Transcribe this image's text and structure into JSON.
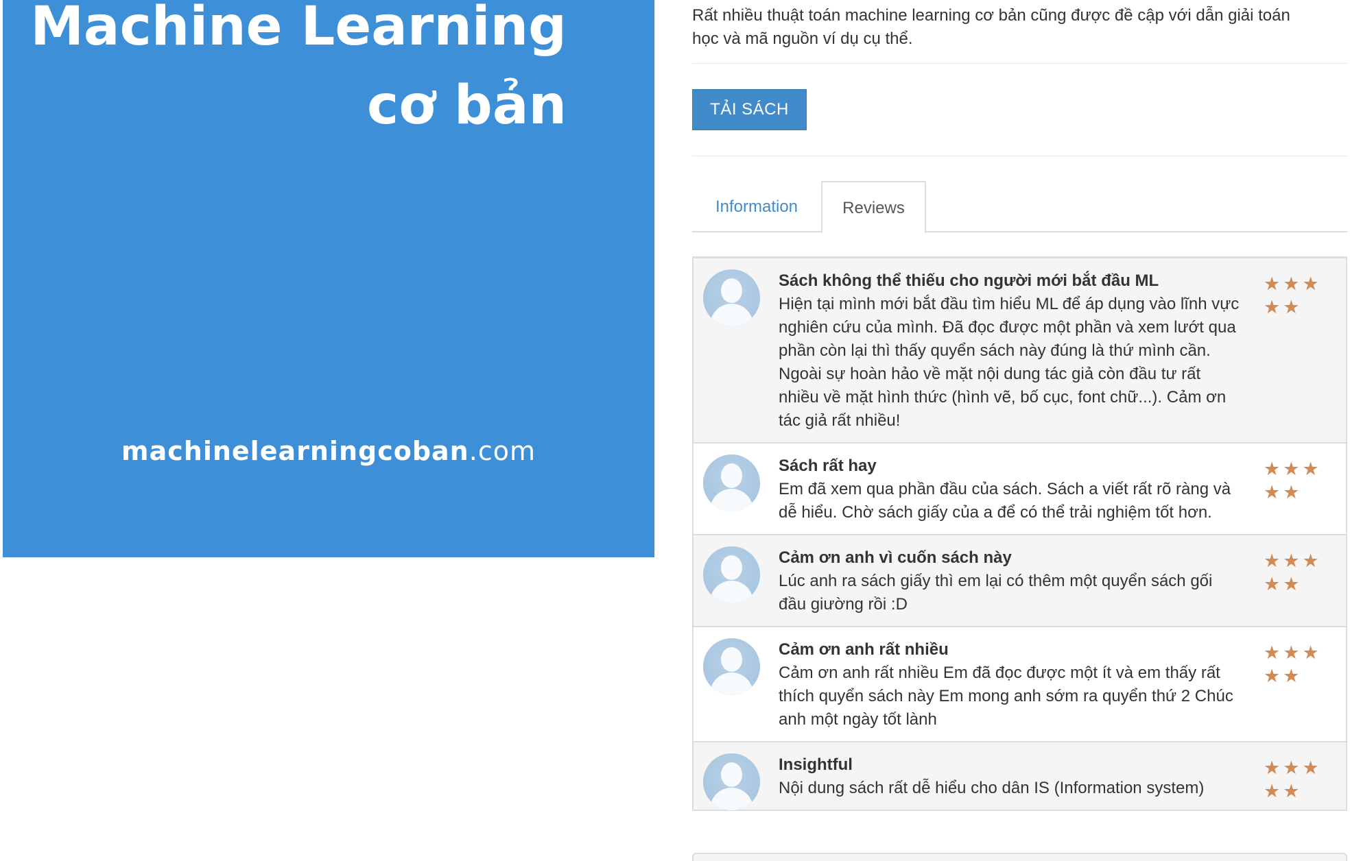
{
  "cover": {
    "title_line1": "Machine Learning",
    "title_line2": "cơ bản",
    "url_main": "machinelearningcoban",
    "url_tld": ".com",
    "background_color": "#3d8fd8"
  },
  "description": {
    "line1": "Rất nhiều thuật toán machine learning cơ bản cũng được đề cập với dẫn giải toán",
    "line2": "học và mã nguồn ví dụ cụ thể."
  },
  "download_button": {
    "label": "TẢI SÁCH"
  },
  "tabs": {
    "information": "Information",
    "reviews": "Reviews"
  },
  "reviews": [
    {
      "title": "Sách không thể thiếu cho người mới bắt đầu ML",
      "text": "Hiện tại mình mới bắt đầu tìm hiểu ML để áp dụng vào lĩnh vực nghiên cứu của mình. Đã đọc được một phần và xem lướt qua phần còn lại thì thấy quyển sách này đúng là thứ mình cần. Ngoài sự hoàn hảo về mặt nội dung tác giả còn đầu tư rất nhiều về mặt hình thức (hình vẽ, bố cục, font chữ...). Cảm ơn tác giả rất nhiều!",
      "rating": 5
    },
    {
      "title": "Sách rất hay",
      "text": "Em đã xem qua phần đầu của sách. Sách a viết rất rõ ràng và dễ hiểu. Chờ sách giấy của a để có thể trải nghiệm tốt hơn.",
      "rating": 5
    },
    {
      "title": "Cảm ơn anh vì cuốn sách này",
      "text": "Lúc anh ra sách giấy thì em lại có thêm một quyển sách gối đầu giường rồi :D",
      "rating": 5
    },
    {
      "title": "Cảm ơn anh rất nhiều",
      "text": "Cảm ơn anh rất nhiều Em đã đọc được một ít và em thấy rất thích quyển sách này Em mong anh sớm ra quyển thứ 2 Chúc anh một ngày tốt lành",
      "rating": 5
    },
    {
      "title": "Insightful",
      "text": "Nội dung sách rất dễ hiểu cho dân IS (Information system)",
      "rating": 5
    }
  ],
  "colors": {
    "accent": "#428bca",
    "star": "#d28b55",
    "avatar": "#c9dcec"
  },
  "icons": {
    "star": "star-icon",
    "avatar": "user-avatar-icon"
  }
}
